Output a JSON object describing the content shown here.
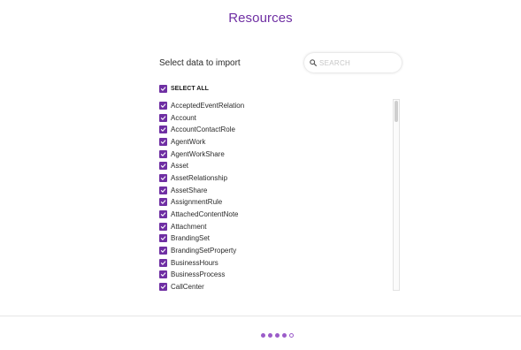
{
  "page": {
    "title": "Resources",
    "subtitle": "Select data to import"
  },
  "search": {
    "placeholder": "SEARCH",
    "value": "",
    "icon": "search-icon"
  },
  "select_all": {
    "label": "SELECT ALL",
    "checked": true
  },
  "items": [
    {
      "label": "AcceptedEventRelation",
      "checked": true
    },
    {
      "label": "Account",
      "checked": true
    },
    {
      "label": "AccountContactRole",
      "checked": true
    },
    {
      "label": "AgentWork",
      "checked": true
    },
    {
      "label": "AgentWorkShare",
      "checked": true
    },
    {
      "label": "Asset",
      "checked": true
    },
    {
      "label": "AssetRelationship",
      "checked": true
    },
    {
      "label": "AssetShare",
      "checked": true
    },
    {
      "label": "AssignmentRule",
      "checked": true
    },
    {
      "label": "AttachedContentNote",
      "checked": true
    },
    {
      "label": "Attachment",
      "checked": true
    },
    {
      "label": "BrandingSet",
      "checked": true
    },
    {
      "label": "BrandingSetProperty",
      "checked": true
    },
    {
      "label": "BusinessHours",
      "checked": true
    },
    {
      "label": "BusinessProcess",
      "checked": true
    },
    {
      "label": "CallCenter",
      "checked": true
    }
  ],
  "pagination": {
    "total_steps": 5,
    "current_step": 4
  },
  "colors": {
    "accent": "#6f2fa3",
    "dot": "#9b5cc9"
  }
}
